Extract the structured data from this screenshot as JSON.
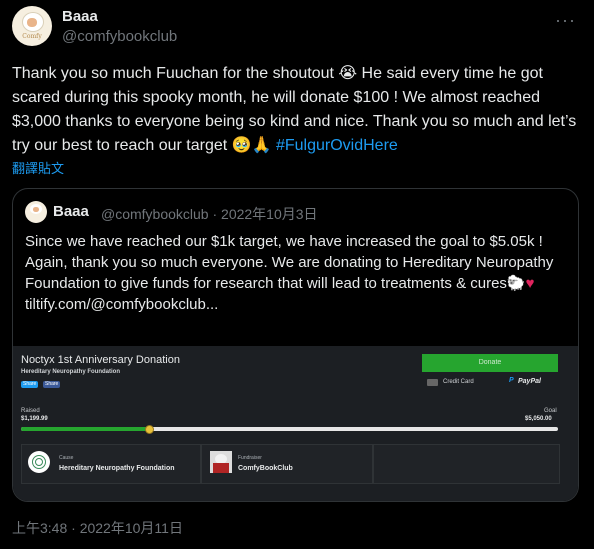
{
  "author": {
    "name": "Baaa",
    "handle": "@comfybookclub",
    "avatar_text": "Comfy Book Club"
  },
  "more_label": "···",
  "tweet": {
    "text": "Thank you so much Fuuchan for the shoutout 😭 He said every time he got scared during this spooky month, he will donate $100 ! We almost reached $3,000 thanks to everyone being so kind and nice. Thank you so much and let’s try our best to reach our target 🥹🙏",
    "hashtag": "#FulgurOvidHere",
    "translate_label": "翻譯貼文",
    "timestamp": "上午3:48 · 2022年10月11日"
  },
  "quote": {
    "name": "Baaa",
    "meta": "@comfybookclub · 2022年10月3日",
    "text": "Since we have reached our $1k target, we have increased the goal to $5.05k ! Again, thank you so much everyone. We are donating to Hereditary Neuropathy Foundation to give funds for research that will lead to treatments & cures🐑",
    "heart": "♥",
    "link": "tiltify.com/@comfybookclub..."
  },
  "card": {
    "title": "Noctyx 1st Anniversary Donation",
    "subtitle": "Hereditary Neuropathy Foundation",
    "share_twitter": "Share",
    "share_facebook": "Share",
    "donate_label": "Donate",
    "credit_card_label": "Credit Card",
    "paypal_label": "PayPal",
    "raised_label": "Raised",
    "raised_value": "$1,199.99",
    "goal_label": "Goal",
    "goal_value": "$5,050.00",
    "progress_fraction": 0.238,
    "cause_label": "Cause",
    "cause_value": "Hereditary Neuropathy Foundation",
    "fundraiser_label": "Fundraiser",
    "fundraiser_value": "ComfyBookClub"
  },
  "colors": {
    "background": "#000000",
    "text": "#e7e9ea",
    "muted": "#71767b",
    "accent": "#1d9bf0",
    "donate_green": "#26a52f",
    "heart": "#e0245e"
  },
  "icons": [
    "more-icon",
    "credit-card-icon",
    "paypal-icon",
    "cause-icon",
    "fundraiser-avatar"
  ]
}
